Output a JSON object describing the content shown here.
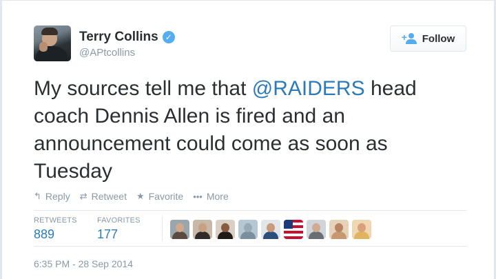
{
  "tweet": {
    "author_name": "Terry Collins",
    "author_handle": "@APtcollins",
    "verified_icon": "verified-check-icon",
    "follow_label": "Follow",
    "text_before": "My sources tell me that ",
    "mention": "@RAIDERS",
    "text_after": " head coach Dennis Allen is fired and an announcement could come as soon as Tuesday",
    "actions": {
      "reply": "Reply",
      "retweet": "Retweet",
      "favorite": "Favorite",
      "more": "More"
    },
    "stats": {
      "retweets_label": "RETWEETS",
      "retweets_value": "889",
      "favorites_label": "FAVORITES",
      "favorites_value": "177"
    },
    "timestamp": "6:35 PM - 28 Sep 2014",
    "colors": {
      "link": "#2b7bb9",
      "muted": "#8899a6",
      "verified": "#55acee",
      "border": "#e1e8ed"
    }
  }
}
